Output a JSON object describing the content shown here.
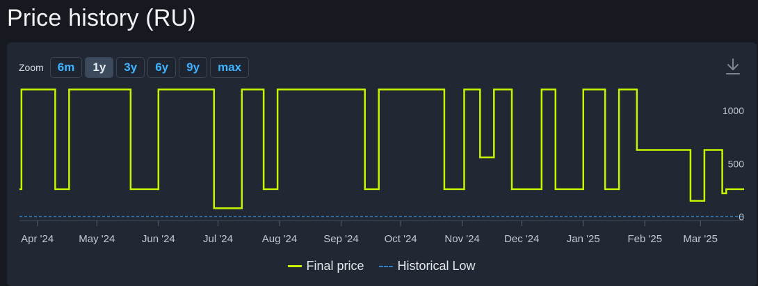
{
  "page": {
    "title": "Price history (RU)"
  },
  "toolbar": {
    "zoom_label": "Zoom",
    "zoom_buttons": [
      {
        "label": "6m",
        "active": false
      },
      {
        "label": "1y",
        "active": true
      },
      {
        "label": "3y",
        "active": false
      },
      {
        "label": "6y",
        "active": false
      },
      {
        "label": "9y",
        "active": false
      },
      {
        "label": "max",
        "active": false
      }
    ],
    "download_icon": "download-icon"
  },
  "colors": {
    "final_price": "#c8f400",
    "historical_low": "#2f7fc4",
    "axis_text": "#c3c8cf",
    "panel": "#212833"
  },
  "chart_data": {
    "type": "line",
    "step": true,
    "x_ticks": [
      "Apr '24",
      "May '24",
      "Jun '24",
      "Jul '24",
      "Aug '24",
      "Sep '24",
      "Oct '24",
      "Nov '24",
      "Dec '24",
      "Jan '25",
      "Feb '25",
      "Mar '25"
    ],
    "x_range": [
      "2024-03-23",
      "2025-03-23"
    ],
    "y_ticks": [
      0,
      500,
      1000
    ],
    "y_axis_position": "right",
    "ylim": [
      -30,
      1250
    ],
    "grid": false,
    "legend": {
      "position": "bottom-center"
    },
    "series": [
      {
        "name": "Final price",
        "color": "#c8f400",
        "points": [
          [
            "2024-03-23",
            260
          ],
          [
            "2024-03-24",
            1200
          ],
          [
            "2024-04-10",
            260
          ],
          [
            "2024-04-17",
            1200
          ],
          [
            "2024-05-18",
            260
          ],
          [
            "2024-06-01",
            1200
          ],
          [
            "2024-06-29",
            80
          ],
          [
            "2024-07-13",
            1200
          ],
          [
            "2024-07-24",
            260
          ],
          [
            "2024-07-31",
            1200
          ],
          [
            "2024-09-13",
            260
          ],
          [
            "2024-09-20",
            1200
          ],
          [
            "2024-10-23",
            260
          ],
          [
            "2024-11-02",
            1200
          ],
          [
            "2024-11-10",
            560
          ],
          [
            "2024-11-17",
            1200
          ],
          [
            "2024-11-26",
            260
          ],
          [
            "2024-12-11",
            1200
          ],
          [
            "2024-12-18",
            260
          ],
          [
            "2025-01-01",
            1200
          ],
          [
            "2025-01-12",
            260
          ],
          [
            "2025-01-19",
            1200
          ],
          [
            "2025-01-28",
            630
          ],
          [
            "2025-02-24",
            150
          ],
          [
            "2025-03-03",
            630
          ],
          [
            "2025-03-12",
            220
          ],
          [
            "2025-03-14",
            260
          ],
          [
            "2025-03-23",
            260
          ]
        ]
      },
      {
        "name": "Historical Low",
        "color": "#2f7fc4",
        "dashed": true,
        "points": [
          [
            "2024-03-23",
            0
          ],
          [
            "2025-03-23",
            0
          ]
        ]
      }
    ]
  },
  "legend": {
    "items": [
      {
        "label": "Final price"
      },
      {
        "label": "Historical Low"
      }
    ]
  }
}
